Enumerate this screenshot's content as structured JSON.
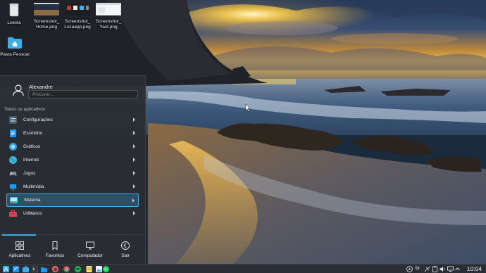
{
  "desktop": {
    "icons": [
      {
        "label": "Lixeira",
        "icon": "trash-icon"
      },
      {
        "label": "Screenshot_Home.png",
        "icon": "image-thumbnail"
      },
      {
        "label": "Screenshot_Lozaapp.png",
        "icon": "image-thumbnail"
      },
      {
        "label": "Screenshot_Yast.png",
        "icon": "image-thumbnail"
      },
      {
        "label": "Pasta Pessoal",
        "icon": "home-folder-icon"
      }
    ]
  },
  "launcher": {
    "user_name": "Alexandre",
    "search_placeholder": "Procurar...",
    "section_title": "Todos os aplicativos",
    "categories": [
      {
        "label": "Configurações",
        "icon": "settings-icon",
        "color": "#6a7480"
      },
      {
        "label": "Escritório",
        "icon": "office-icon",
        "color": "#1d99f3"
      },
      {
        "label": "Gráficos",
        "icon": "graphics-icon",
        "color": "#2f9ee8"
      },
      {
        "label": "Internet",
        "icon": "internet-globe-icon",
        "color": "#3daee9"
      },
      {
        "label": "Jogos",
        "icon": "gamepad-icon",
        "color": "#6a7480"
      },
      {
        "label": "Multimídia",
        "icon": "multimedia-icon",
        "color": "#1d99f3"
      },
      {
        "label": "Sistema",
        "icon": "system-icon",
        "color": "#3daee9",
        "selected": true
      },
      {
        "label": "Utilitários",
        "icon": "toolbox-icon",
        "color": "#da4453"
      }
    ],
    "tabs": [
      {
        "label": "Aplicativos",
        "icon": "apps-grid-icon",
        "active": true
      },
      {
        "label": "Favoritos",
        "icon": "bookmark-icon",
        "active": false
      },
      {
        "label": "Computador",
        "icon": "monitor-icon",
        "active": false
      },
      {
        "label": "Sair",
        "icon": "back-arrow-icon",
        "active": false
      }
    ]
  },
  "panel": {
    "keyboard_layout": "br",
    "clock": "10:04",
    "accent": "#3daee9"
  }
}
